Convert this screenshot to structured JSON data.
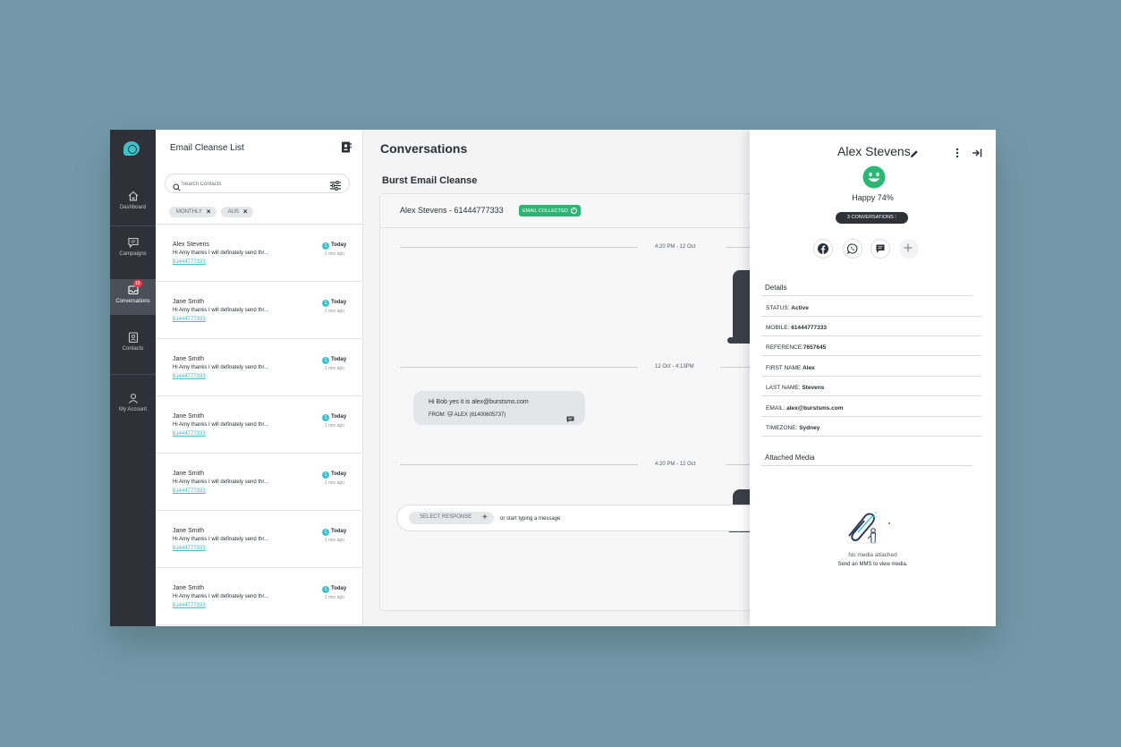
{
  "sidebar": {
    "items": [
      {
        "label": "Dashboard",
        "icon": "home-icon"
      },
      {
        "label": "Campaigns",
        "icon": "chat-icon"
      },
      {
        "label": "Conversations",
        "icon": "inbox-icon",
        "badge": "15",
        "active": true
      },
      {
        "label": "Contacts",
        "icon": "contact-card-icon"
      },
      {
        "label": "My Account",
        "icon": "user-icon"
      }
    ]
  },
  "list": {
    "title": "Email Cleanse List",
    "search_placeholder": "Search Contacts",
    "filters": [
      "MONTHLY",
      "AUS"
    ],
    "contacts": [
      {
        "name": "Alex Stevens",
        "preview": "Hi Amy thanks I will definately send thr...",
        "number": "61444777333",
        "unread": "1",
        "date": "Today",
        "ago": "1 min ago"
      },
      {
        "name": "Jane Smith",
        "preview": "Hi Amy thanks I will definately send thr...",
        "number": "61444777333",
        "unread": "1",
        "date": "Today",
        "ago": "1 min ago"
      },
      {
        "name": "Jane Smith",
        "preview": "Hi Amy thanks I will definately send thr...",
        "number": "61444777333",
        "unread": "1",
        "date": "Today",
        "ago": "1 min ago"
      },
      {
        "name": "Jane Smith",
        "preview": "Hi Amy thanks I will definately send thr...",
        "number": "61444777333",
        "unread": "1",
        "date": "Today",
        "ago": "1 min ago"
      },
      {
        "name": "Jane Smith",
        "preview": "Hi Amy thanks I will definately send thr...",
        "number": "61444777333",
        "unread": "1",
        "date": "Today",
        "ago": "1 min ago"
      },
      {
        "name": "Jane Smith",
        "preview": "Hi Amy thanks I will definately send thr...",
        "number": "61444777333",
        "unread": "1",
        "date": "Today",
        "ago": "1 min ago"
      },
      {
        "name": "Jane Smith",
        "preview": "Hi Amy thanks I will definately send thr...",
        "number": "61444777333",
        "unread": "1",
        "date": "Today",
        "ago": "1 min ago"
      }
    ]
  },
  "main": {
    "title": "Conversations",
    "subtitle": "Burst Email Cleanse",
    "header_name": "Alex Stevens - 61444777333",
    "status_badge": "EMAIL COLLECTED",
    "separators": [
      "4:20 PM - 12 Oct",
      "12 Oct - 4:13PM",
      "4:20 PM - 12 Oct"
    ],
    "incoming": {
      "text": "Hi Bob yes it is alex@burstsms.com",
      "from": "FROM: 🐱 ALEX (61400605737)"
    },
    "composer": {
      "select_label": "SELECT RESPONSE",
      "placeholder": "or start typing a message"
    }
  },
  "profile": {
    "name": "Alex Stevens",
    "mood": "Happy 74%",
    "conversations": "3 CONVERSATIONS ⁝",
    "details_title": "Details",
    "details": [
      {
        "label": "STATUS:",
        "value": "Active"
      },
      {
        "label": "MOBILE:",
        "value": "61444777333"
      },
      {
        "label": "REFERENCE:",
        "value": "7657645"
      },
      {
        "label": "FIRST NAME",
        "value": "Alex"
      },
      {
        "label": "LAST NAME:",
        "value": "Stevens"
      },
      {
        "label": "EMAIL:",
        "value": "alex@burstsms.com"
      },
      {
        "label": "TIMEZONE:",
        "value": "Sydney"
      }
    ],
    "media_title": "Attached Media",
    "no_media": "No media attached",
    "no_media_sub": "Send an MMS to view media."
  },
  "colors": {
    "accent": "#3fc1c9",
    "success": "#2bb673",
    "sidebar": "#2e3138",
    "background": "#7399a8"
  }
}
